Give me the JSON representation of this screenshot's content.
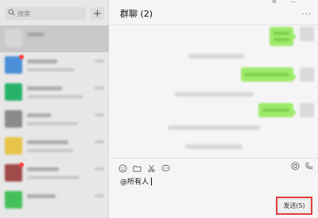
{
  "search": {
    "placeholder": "搜索"
  },
  "sidebar": {
    "add_label": "+",
    "conversations": [
      {
        "avatar_color": "#d6d6d6",
        "selected": true
      },
      {
        "avatar_color": "#4a8fd8",
        "selected": false,
        "badge": true
      },
      {
        "avatar_color": "#27b36a",
        "selected": false
      },
      {
        "avatar_color": "#8a8a8a",
        "selected": false
      },
      {
        "avatar_color": "#e8c44a",
        "selected": false
      },
      {
        "avatar_color": "#a04a4a",
        "selected": false,
        "badge": true
      },
      {
        "avatar_color": "#44c05a",
        "selected": false
      }
    ]
  },
  "chat": {
    "title": "群聊 (2)",
    "more_label": "...",
    "window_pin": "⊕",
    "window_min": "—",
    "input_text": "@所有人",
    "send_label": "发送(S)"
  },
  "colors": {
    "bubble_green": "#9eea6a",
    "highlight_red": "#e23b3b",
    "sidebar_bg": "#e8e7e7",
    "chat_bg": "#f5f5f5"
  },
  "toolbar_icons": [
    "emoji-icon",
    "folder-icon",
    "scissors-icon",
    "chat-bubble-icon"
  ],
  "toolbar_right_icons": [
    "video-call-icon",
    "phone-icon"
  ]
}
